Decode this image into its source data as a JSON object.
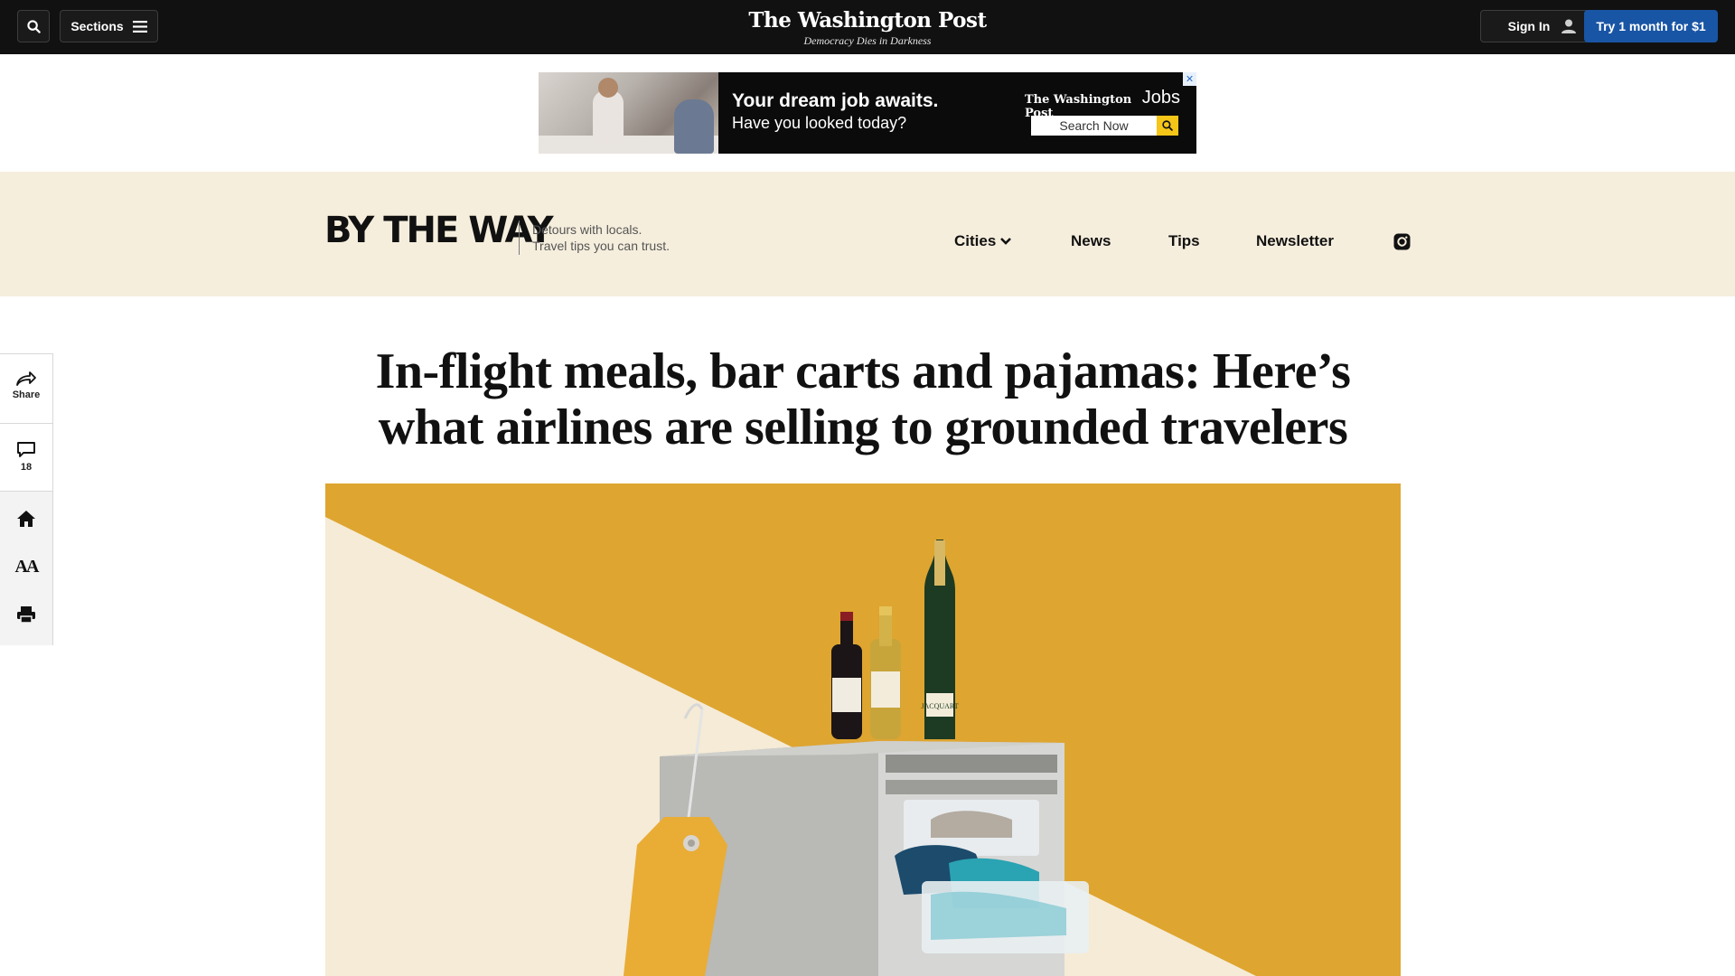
{
  "topbar": {
    "sections_label": "Sections",
    "signin_label": "Sign In",
    "try_label": "Try 1 month for $1",
    "logo": "The Washington Post",
    "tagline": "Democracy Dies in Darkness",
    "icons": [
      "search-icon",
      "hamburger-icon",
      "user-icon"
    ]
  },
  "ad": {
    "headline": "Your dream job awaits.",
    "subline": "Have you looked today?",
    "brand": "The Washington Post",
    "brand_suffix": "Jobs",
    "search_label": "Search Now",
    "close_glyph": "✕"
  },
  "section_band": {
    "logo": "BY THE WAY",
    "tagline_1": "Detours with locals.",
    "tagline_2": "Travel tips you can trust.",
    "nav": [
      "Cities",
      "News",
      "Tips",
      "Newsletter"
    ],
    "background": "#f6eedd"
  },
  "rail": {
    "share_label": "Share",
    "comments_count": "18",
    "text_size_glyph": "AA"
  },
  "article": {
    "headline": "In-flight meals, bar carts and pajamas: Here’s what airlines are selling to grounded travelers"
  },
  "hero": {
    "background": "#dea530",
    "cream": "#f5ebd6",
    "champagne_label": "JACQUART",
    "colors": {
      "cart": "#b9b9b6",
      "tag": "#e9ac35"
    }
  }
}
